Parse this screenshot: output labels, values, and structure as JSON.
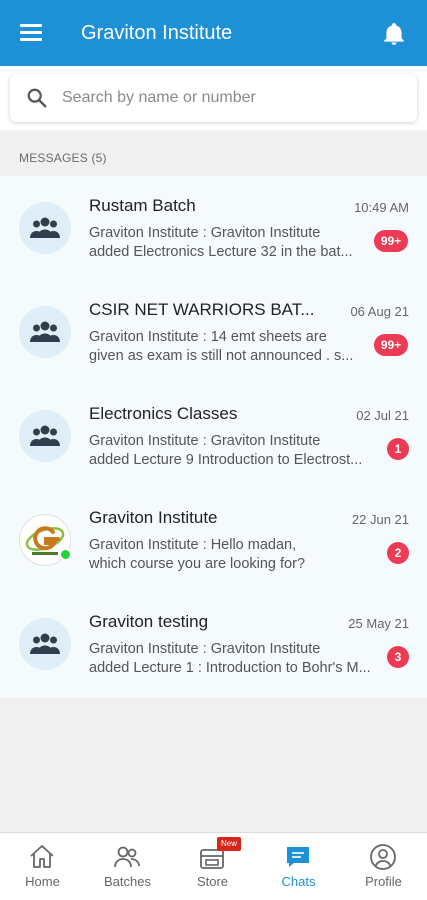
{
  "appbar": {
    "title": "Graviton Institute",
    "menu_icon": "hamburger-menu-icon",
    "bell_icon": "bell-icon"
  },
  "search": {
    "placeholder": "Search by name or number",
    "value": ""
  },
  "section_label": "MESSAGES (5)",
  "messages": [
    {
      "name": "Rustam Batch",
      "time": "10:49 AM",
      "preview_line1": "Graviton Institute  :  Graviton Institute",
      "preview_line2": "added Electronics Lecture 32 in the bat...",
      "badge": "99+",
      "avatar": "group-icon"
    },
    {
      "name": "CSIR NET WARRIORS BAT...",
      "time": "06 Aug 21",
      "preview_line1": "Graviton Institute  :  14 emt sheets are",
      "preview_line2": "given as exam is still not announced . s...",
      "badge": "99+",
      "avatar": "group-icon"
    },
    {
      "name": "Electronics Classes",
      "time": "02 Jul 21",
      "preview_line1": "Graviton Institute  :  Graviton Institute",
      "preview_line2": "added Lecture 9 Introduction to Electrost...",
      "badge": "1",
      "avatar": "group-icon"
    },
    {
      "name": "Graviton Institute",
      "time": "22 Jun 21",
      "preview_line1": "Graviton Institute  :  Hello madan,",
      "preview_line2": "which course you are looking for?",
      "badge": "2",
      "avatar": "graviton-logo-icon",
      "online": true
    },
    {
      "name": "Graviton testing",
      "time": "25 May 21",
      "preview_line1": "Graviton Institute  :  Graviton Institute",
      "preview_line2": "added Lecture 1 : Introduction to Bohr's M...",
      "badge": "3",
      "avatar": "group-icon"
    }
  ],
  "bottom_nav": {
    "tabs": [
      {
        "label": "Home",
        "icon": "home-icon"
      },
      {
        "label": "Batches",
        "icon": "batches-icon"
      },
      {
        "label": "Store",
        "icon": "store-icon",
        "badge": "New"
      },
      {
        "label": "Chats",
        "icon": "chat-icon",
        "active": true
      },
      {
        "label": "Profile",
        "icon": "profile-icon"
      }
    ]
  },
  "colors": {
    "primary": "#1e90d6",
    "badge": "#ee3b55",
    "online": "#22d43a",
    "new_badge": "#d9261c"
  }
}
